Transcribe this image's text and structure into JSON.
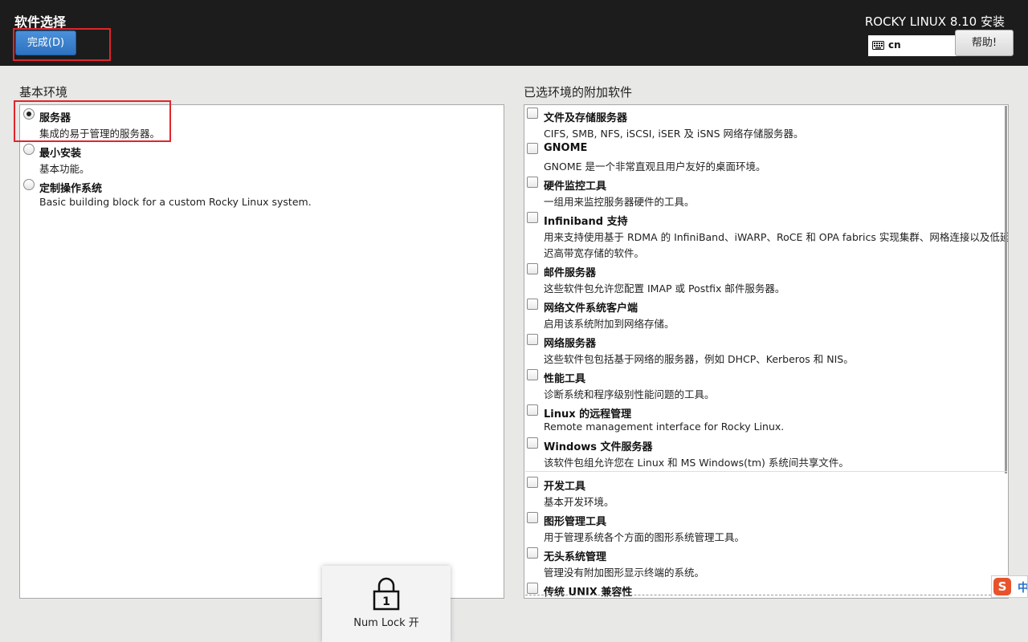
{
  "header": {
    "title": "软件选择",
    "done_label": "完成(D)",
    "install_title": "ROCKY LINUX 8.10 安装",
    "keyboard_layout": "cn",
    "help_label": "帮助!"
  },
  "base_env": {
    "heading": "基本环境",
    "options": [
      {
        "title": "服务器",
        "desc": "集成的易于管理的服务器。",
        "selected": true
      },
      {
        "title": "最小安装",
        "desc": "基本功能。",
        "selected": false
      },
      {
        "title": "定制操作系统",
        "desc": "Basic building block for a custom Rocky Linux system.",
        "selected": false
      }
    ]
  },
  "addons": {
    "heading": "已选环境的附加软件",
    "items": [
      {
        "title": "文件及存储服务器",
        "desc": "CIFS, SMB, NFS, iSCSI, iSER 及 iSNS 网络存储服务器。"
      },
      {
        "title": "GNOME",
        "desc": "GNOME 是一个非常直观且用户友好的桌面环境。"
      },
      {
        "title": "硬件监控工具",
        "desc": "一组用来监控服务器硬件的工具。"
      },
      {
        "title": "Infiniband 支持",
        "desc": "用来支持使用基于 RDMA 的 InfiniBand、iWARP、RoCE 和 OPA fabrics 实现集群、网格连接以及低延",
        "desc2": "迟高带宽存储的软件。"
      },
      {
        "title": "邮件服务器",
        "desc": "这些软件包允许您配置 IMAP 或 Postfix 邮件服务器。"
      },
      {
        "title": "网络文件系统客户端",
        "desc": "启用该系统附加到网络存储。"
      },
      {
        "title": "网络服务器",
        "desc": "这些软件包包括基于网络的服务器，例如 DHCP、Kerberos 和 NIS。"
      },
      {
        "title": "性能工具",
        "desc": "诊断系统和程序级别性能问题的工具。"
      },
      {
        "title": "Linux 的远程管理",
        "desc": "Remote management interface for Rocky Linux."
      },
      {
        "title": "Windows 文件服务器",
        "desc": "该软件包组允许您在 Linux 和 MS Windows(tm) 系统间共享文件。"
      },
      {
        "title": "开发工具",
        "desc": "基本开发环境。"
      },
      {
        "title": "图形管理工具",
        "desc": "用于管理系统各个方面的图形系统管理工具。"
      },
      {
        "title": "无头系统管理",
        "desc": "管理没有附加图形显示终端的系统。"
      },
      {
        "title": "传统 UNIX 兼容性",
        "desc": ""
      }
    ]
  },
  "numlock": {
    "label": "Num Lock 开",
    "key_number": "1"
  },
  "ime": {
    "logo": "S",
    "mode": "中"
  },
  "colors": {
    "accent": "#e0252b",
    "done_button": "#3a80cf"
  }
}
